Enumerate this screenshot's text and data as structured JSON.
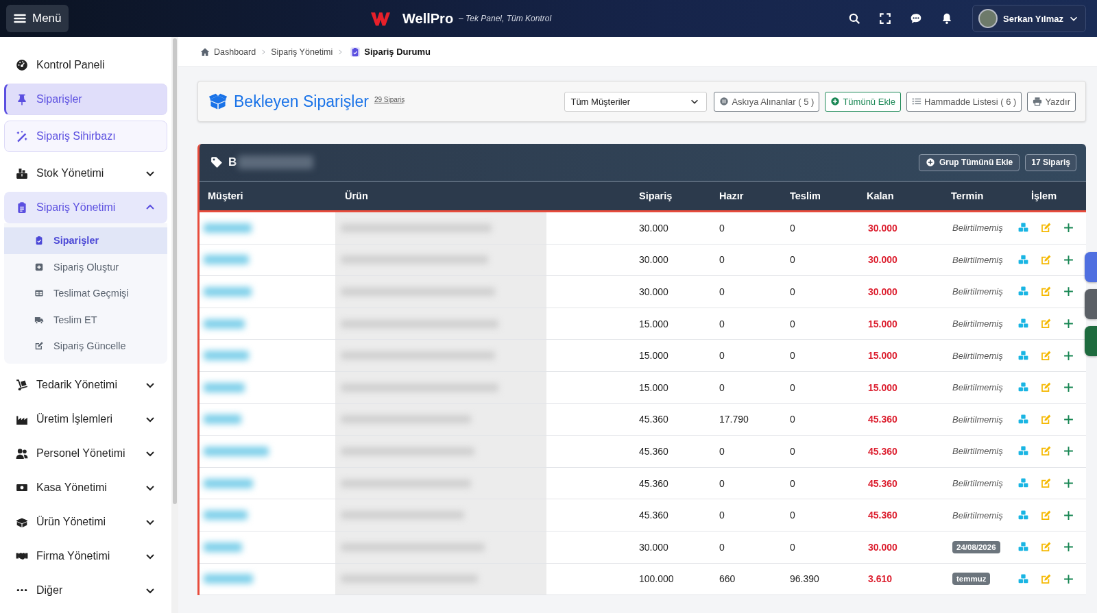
{
  "topbar": {
    "menu_label": "Menü",
    "brand": "WellPro",
    "tagline": "– Tek Panel, Tüm Kontrol",
    "user_name": "Serkan Yılmaz"
  },
  "sidebar": {
    "items": [
      {
        "label": "Kontrol Paneli",
        "kind": "plain",
        "selected": false
      },
      {
        "label": "Siparişler",
        "kind": "pill",
        "selected": true
      },
      {
        "label": "Sipariş Sihirbazı",
        "kind": "pill",
        "selected": false
      },
      {
        "label": "Stok Yönetimi",
        "kind": "group",
        "expanded": false
      },
      {
        "label": "Sipariş Yönetimi",
        "kind": "group",
        "expanded": true,
        "children": [
          {
            "label": "Siparişler",
            "selected": true
          },
          {
            "label": "Sipariş Oluştur",
            "selected": false
          },
          {
            "label": "Teslimat Geçmişi",
            "selected": false
          },
          {
            "label": "Teslim ET",
            "selected": false
          },
          {
            "label": "Sipariş Güncelle",
            "selected": false
          }
        ]
      },
      {
        "label": "Tedarik Yönetimi",
        "kind": "group",
        "expanded": false
      },
      {
        "label": "Üretim İşlemleri",
        "kind": "group",
        "expanded": false
      },
      {
        "label": "Personel Yönetimi",
        "kind": "group",
        "expanded": false
      },
      {
        "label": "Kasa Yönetimi",
        "kind": "group",
        "expanded": false
      },
      {
        "label": "Ürün Yönetimi",
        "kind": "group",
        "expanded": false
      },
      {
        "label": "Firma Yönetimi",
        "kind": "group",
        "expanded": false
      },
      {
        "label": "Diğer",
        "kind": "group",
        "expanded": false
      }
    ]
  },
  "breadcrumb": [
    "Dashboard",
    "Sipariş Yönetimi",
    "Sipariş Durumu"
  ],
  "header": {
    "title": "Bekleyen Siparişler",
    "count_link": "29 Sipariş",
    "customer_select": "Tüm Müşteriler",
    "buttons": [
      {
        "label": "Askıya Alınanlar ( 5 )",
        "kind": "outline"
      },
      {
        "label": "Tümünü Ekle",
        "kind": "success"
      },
      {
        "label": "Hammadde Listesi ( 6 )",
        "kind": "outline"
      },
      {
        "label": "Yazdır",
        "kind": "outline"
      }
    ]
  },
  "group": {
    "title": "B",
    "add_button": "Grup Tümünü Ekle",
    "count": "17 Sipariş"
  },
  "table": {
    "columns": [
      "Müşteri",
      "Ürün",
      "Sipariş",
      "Hazır",
      "Teslim",
      "Kalan",
      "Termin",
      "İşlem"
    ],
    "rows": [
      {
        "siparis": "30.000",
        "hazir": "0",
        "teslim": "0",
        "kalan": "30.000",
        "termin": "Belirtilmemiş",
        "termin_badge": false
      },
      {
        "siparis": "30.000",
        "hazir": "0",
        "teslim": "0",
        "kalan": "30.000",
        "termin": "Belirtilmemiş",
        "termin_badge": false
      },
      {
        "siparis": "30.000",
        "hazir": "0",
        "teslim": "0",
        "kalan": "30.000",
        "termin": "Belirtilmemiş",
        "termin_badge": false
      },
      {
        "siparis": "15.000",
        "hazir": "0",
        "teslim": "0",
        "kalan": "15.000",
        "termin": "Belirtilmemiş",
        "termin_badge": false
      },
      {
        "siparis": "15.000",
        "hazir": "0",
        "teslim": "0",
        "kalan": "15.000",
        "termin": "Belirtilmemiş",
        "termin_badge": false
      },
      {
        "siparis": "15.000",
        "hazir": "0",
        "teslim": "0",
        "kalan": "15.000",
        "termin": "Belirtilmemiş",
        "termin_badge": false
      },
      {
        "siparis": "45.360",
        "hazir": "17.790",
        "teslim": "0",
        "kalan": "45.360",
        "termin": "Belirtilmemiş",
        "termin_badge": false
      },
      {
        "siparis": "45.360",
        "hazir": "0",
        "teslim": "0",
        "kalan": "45.360",
        "termin": "Belirtilmemiş",
        "termin_badge": false
      },
      {
        "siparis": "45.360",
        "hazir": "0",
        "teslim": "0",
        "kalan": "45.360",
        "termin": "Belirtilmemiş",
        "termin_badge": false
      },
      {
        "siparis": "45.360",
        "hazir": "0",
        "teslim": "0",
        "kalan": "45.360",
        "termin": "Belirtilmemiş",
        "termin_badge": false
      },
      {
        "siparis": "30.000",
        "hazir": "0",
        "teslim": "0",
        "kalan": "30.000",
        "termin": "24/08/2026",
        "termin_badge": true
      },
      {
        "siparis": "100.000",
        "hazir": "660",
        "teslim": "96.390",
        "kalan": "3.610",
        "termin": "temmuz",
        "termin_badge": true
      }
    ]
  }
}
